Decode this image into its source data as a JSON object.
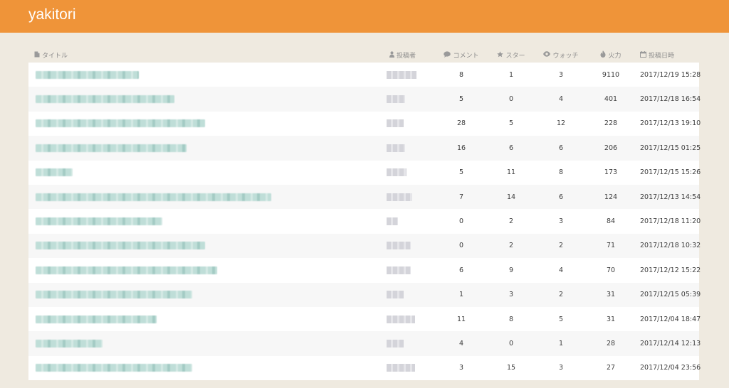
{
  "app": {
    "title": "yakitori"
  },
  "columns": {
    "title": "タイトル",
    "author": "投稿者",
    "comment": "コメント",
    "star": "スター",
    "watch": "ウォッチ",
    "fire": "火力",
    "date": "投稿日時"
  },
  "rows": [
    {
      "comments": "8",
      "stars": "1",
      "watches": "3",
      "fire": "9110",
      "date": "2017/12/19 15:28"
    },
    {
      "comments": "5",
      "stars": "0",
      "watches": "4",
      "fire": "401",
      "date": "2017/12/18 16:54"
    },
    {
      "comments": "28",
      "stars": "5",
      "watches": "12",
      "fire": "228",
      "date": "2017/12/13 19:10"
    },
    {
      "comments": "16",
      "stars": "6",
      "watches": "6",
      "fire": "206",
      "date": "2017/12/15 01:25"
    },
    {
      "comments": "5",
      "stars": "11",
      "watches": "8",
      "fire": "173",
      "date": "2017/12/15 15:26"
    },
    {
      "comments": "7",
      "stars": "14",
      "watches": "6",
      "fire": "124",
      "date": "2017/12/13 14:54"
    },
    {
      "comments": "0",
      "stars": "2",
      "watches": "3",
      "fire": "84",
      "date": "2017/12/18 11:20"
    },
    {
      "comments": "0",
      "stars": "2",
      "watches": "2",
      "fire": "71",
      "date": "2017/12/18 10:32"
    },
    {
      "comments": "6",
      "stars": "9",
      "watches": "4",
      "fire": "70",
      "date": "2017/12/12 15:22"
    },
    {
      "comments": "1",
      "stars": "3",
      "watches": "2",
      "fire": "31",
      "date": "2017/12/15 05:39"
    },
    {
      "comments": "11",
      "stars": "8",
      "watches": "5",
      "fire": "31",
      "date": "2017/12/04 18:47"
    },
    {
      "comments": "4",
      "stars": "0",
      "watches": "1",
      "fire": "28",
      "date": "2017/12/14 12:13"
    },
    {
      "comments": "3",
      "stars": "15",
      "watches": "3",
      "fire": "27",
      "date": "2017/12/04 23:56"
    }
  ]
}
